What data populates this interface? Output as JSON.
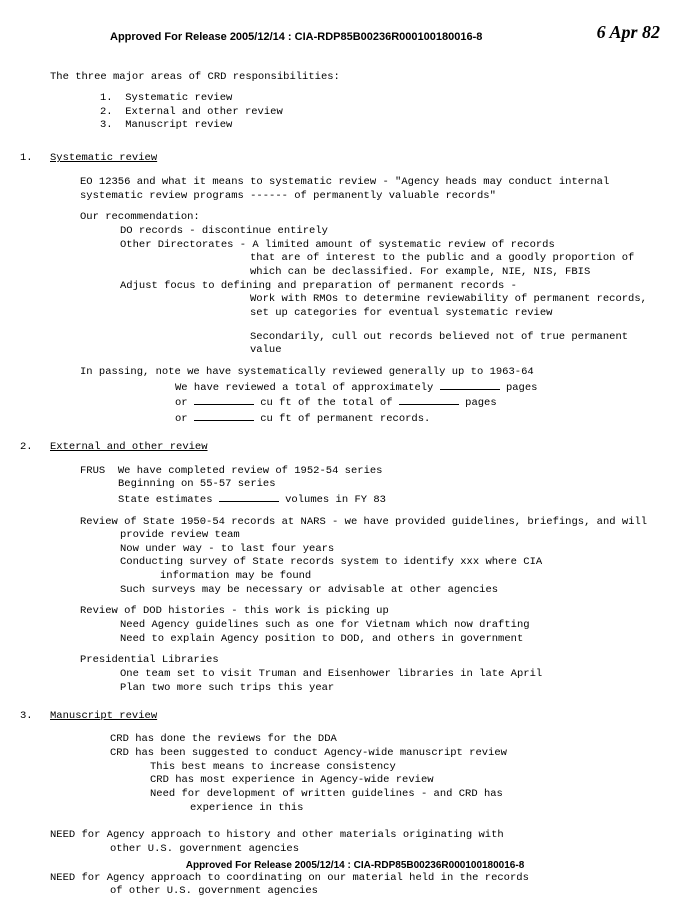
{
  "handwritten_date": "6 Apr 82",
  "header_stamp": "Approved For Release 2005/12/14 : CIA-RDP85B00236R000100180016-8",
  "footer_stamp": "Approved For Release 2005/12/14 : CIA-RDP85B00236R000100180016-8",
  "intro": "The three major areas of CRD responsibilities:",
  "areas": {
    "1": "Systematic review",
    "2": "External and other review",
    "3": "Manuscript review"
  },
  "s1": {
    "num": "1.",
    "title": "Systematic review",
    "eo": "EO 12356 and what it means to systematic review - \"Agency heads may conduct internal systematic review programs ------ of permanently valuable records\"",
    "rec_label": "Our recommendation:",
    "rec_do": "DO records - discontinue entirely",
    "rec_other1": "Other Directorates - A limited amount of systematic review of records that are of interest to the public and a goodly proportion of which can be declassified.  For example, NIE, NIS, FBIS",
    "rec_other2_indented": "that are of interest to the public and a goodly proportion of which can be declassified.  For example, NIE, NIS, FBIS",
    "rec_other_first": "Other Directorates - A limited amount of systematic review of records",
    "adjust_first": "Adjust focus to defining and preparation of permanent records -",
    "adjust_rest": "Work with RMOs to determine reviewability of permanent records, set up categories for eventual systematic review",
    "secondary": "Secondarily, cull out records believed not of true permanent value",
    "passing_first": "In passing, note we have systematically reviewed generally up to 1963-64",
    "passing_l2a": "We have reviewed a total of approximately ",
    "passing_l2b": " pages",
    "passing_l3a": "or ",
    "passing_l3b": " cu ft of the total of ",
    "passing_l3c": " pages",
    "passing_l4a": "or ",
    "passing_l4b": " cu ft of permanent records."
  },
  "s2": {
    "num": "2.",
    "title": "External and other review",
    "frus_label": "FRUS",
    "frus1": "We have completed review of 1952-54 series",
    "frus2": "Beginning on 55-57 series",
    "frus3a": "State estimates ",
    "frus3b": " volumes in FY 83",
    "state1": "Review of State 1950-54 records at NARS - we have provided guidelines, briefings, and will provide review team",
    "state2": "Now under way -  to last four years",
    "state3": "Conducting survey of State records system to identify xxx where CIA information may be found",
    "state3_rest": "information may be found",
    "state3_first": "Conducting survey of State records system to identify xxx where CIA",
    "state4": "Such surveys may be necessary or advisable at other agencies",
    "dod1": "Review of DOD histories - this work is picking up",
    "dod2": "Need Agency guidelines such as one for Vietnam which now drafting",
    "dod3": "Need to explain Agency position to DOD, and others in government",
    "pres_label": "Presidential Libraries",
    "pres1": "One team set to visit Truman and Eisenhower libraries in late April",
    "pres2": "Plan two more such trips this year"
  },
  "s3": {
    "num": "3.",
    "title": "Manuscript review",
    "m1": "CRD has done the reviews for the DDA",
    "m2": "CRD has been suggested to conduct Agency-wide manuscript review",
    "m3": "This best means to increase consistency",
    "m4": "CRD has most experience in Agency-wide review",
    "m5": "Need for development of written guidelines - and CRD has experience in this",
    "m5_first": "Need for development of written guidelines - and CRD has",
    "m5_rest": "experience in this"
  },
  "need1_first": "NEED for Agency approach to history and other materials originating with",
  "need1_rest": "other U.S. government agencies",
  "need2_first": "NEED for Agency approach to coordinating on our material held in the records",
  "need2_rest": "of other U.S. government agencies"
}
